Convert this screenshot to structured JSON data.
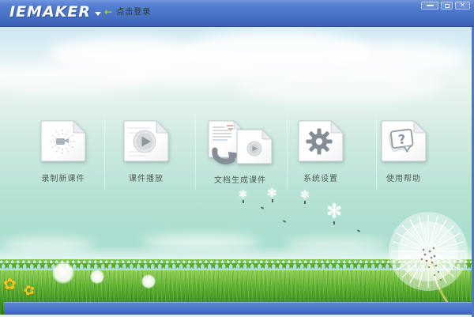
{
  "titlebar": {
    "logo": "IEMAKER",
    "login": {
      "arrow": "←",
      "label": "点击登录"
    },
    "controls": {
      "minimize": "minimize",
      "maximize": "maximize",
      "close": "✕"
    }
  },
  "menu": {
    "items": [
      {
        "id": "record-new-courseware",
        "label": "录制新课件"
      },
      {
        "id": "courseware-playback",
        "label": "课件播放"
      },
      {
        "id": "doc-generate-courseware",
        "label": "文档生成课件"
      },
      {
        "id": "system-settings",
        "label": "系统设置"
      },
      {
        "id": "usage-help",
        "label": "使用帮助"
      }
    ]
  },
  "colors": {
    "titlebar_blue": "#4a74c8",
    "bottombar_blue": "#4a73c8",
    "login_arrow_green": "#b6d300",
    "menu_label_text": "#4e5e57",
    "grass_green": "#58a92d",
    "sky_blue": "#cfe8f3",
    "mint_green": "#abdfd2",
    "page_icon_gray": "#8b949b"
  }
}
